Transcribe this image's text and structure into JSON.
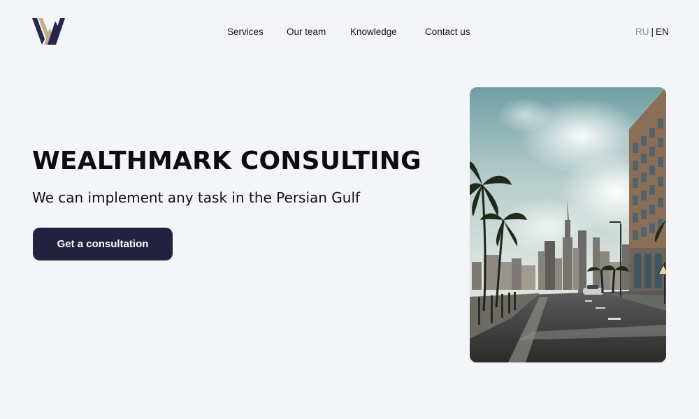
{
  "header": {
    "logo_icon": "wealthmark-w-logo-icon",
    "nav": [
      {
        "label": "Services"
      },
      {
        "label": "Our team"
      },
      {
        "label": "Knowledge"
      },
      {
        "label": "Contact us"
      }
    ],
    "lang": {
      "ru": "RU",
      "separator": "|",
      "en": "EN",
      "active": "EN"
    }
  },
  "hero": {
    "title": "WEALTHMARK CONSULTING",
    "subtitle": "We can implement any task in the Persian Gulf",
    "cta_label": "Get a consultation",
    "image_icon": "dubai-skyline-photo"
  },
  "colors": {
    "background": "#f3f5f9",
    "button": "#22223e",
    "logo_dark": "#25264a",
    "logo_accent": "#c7a98a",
    "inactive_lang": "#8a8d94"
  }
}
